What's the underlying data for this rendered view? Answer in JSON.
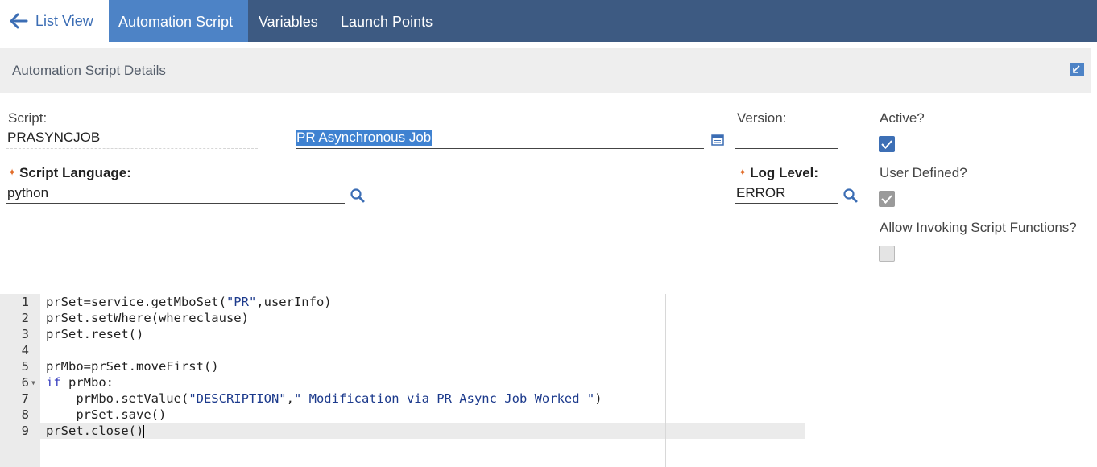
{
  "tabs": {
    "list_view": "List View",
    "automation_script": "Automation Script",
    "variables": "Variables",
    "launch_points": "Launch Points"
  },
  "section": {
    "title": "Automation Script Details"
  },
  "fields": {
    "script_label": "Script:",
    "script_value": "PRASYNCJOB",
    "description_value": "PR Asynchronous Job",
    "version_label": "Version:",
    "version_value": "",
    "language_label": "Script Language:",
    "language_value": "python",
    "loglevel_label": "Log Level:",
    "loglevel_value": "ERROR",
    "active_label": "Active?",
    "active_checked": true,
    "user_defined_label": "User Defined?",
    "user_defined_checked": true,
    "allow_invoking_label": "Allow Invoking Script Functions?",
    "allow_invoking_checked": false
  },
  "editor": {
    "lines": [
      {
        "n": "1",
        "text": "prSet=service.getMboSet(\"PR\",userInfo)"
      },
      {
        "n": "2",
        "text": "prSet.setWhere(whereclause)"
      },
      {
        "n": "3",
        "text": "prSet.reset()"
      },
      {
        "n": "4",
        "text": ""
      },
      {
        "n": "5",
        "text": "prMbo=prSet.moveFirst()"
      },
      {
        "n": "6",
        "text": "if prMbo:"
      },
      {
        "n": "7",
        "text": "    prMbo.setValue(\"DESCRIPTION\",\" Modification via PR Async Job Worked \")"
      },
      {
        "n": "8",
        "text": "    prSet.save()"
      },
      {
        "n": "9",
        "text": "prSet.close()"
      }
    ]
  },
  "colors": {
    "tabbar": "#3d5a82",
    "active_tab": "#4d83c6",
    "accent": "#3b6db4",
    "checkbox": "#3d6fb5",
    "required": "#e26d2a"
  },
  "icons": {
    "back": "arrow-left-icon",
    "collapse": "collapse-arrow-icon",
    "calendar": "long-description-icon",
    "search": "magnifier-icon"
  }
}
